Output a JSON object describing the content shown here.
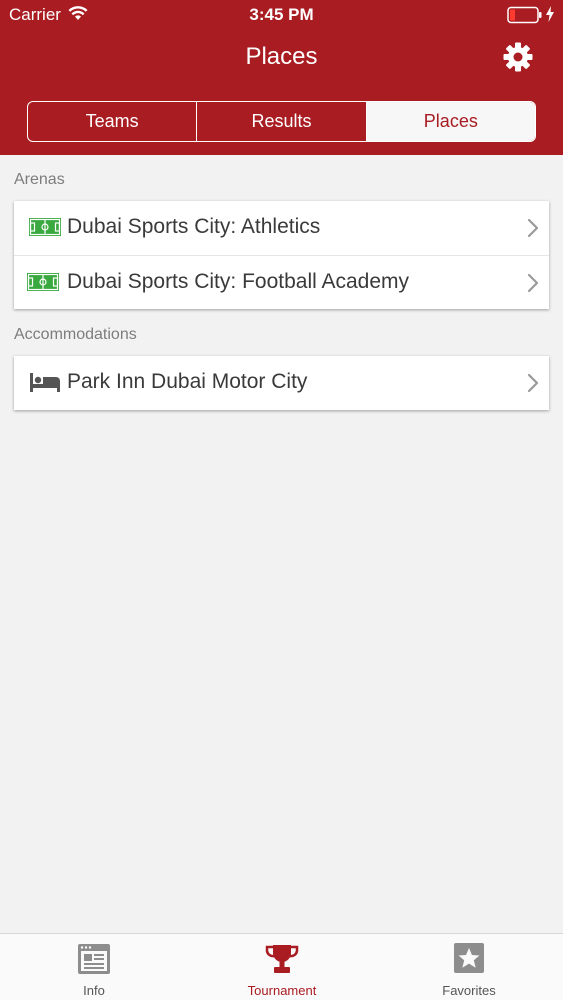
{
  "status_bar": {
    "carrier": "Carrier",
    "time": "3:45 PM"
  },
  "nav": {
    "title": "Places",
    "settings_icon": "gear-icon"
  },
  "segments": [
    {
      "label": "Teams",
      "selected": false
    },
    {
      "label": "Results",
      "selected": false
    },
    {
      "label": "Places",
      "selected": true
    }
  ],
  "sections": [
    {
      "title": "Arenas",
      "items": [
        {
          "label": "Dubai Sports City: Athletics",
          "icon": "football-pitch-icon"
        },
        {
          "label": "Dubai Sports City: Football Academy",
          "icon": "football-pitch-icon"
        }
      ]
    },
    {
      "title": "Accommodations",
      "items": [
        {
          "label": "Park Inn Dubai Motor City",
          "icon": "bed-icon"
        }
      ]
    }
  ],
  "tabbar": {
    "tabs": [
      {
        "label": "Info",
        "icon": "info-browser-icon",
        "active": false
      },
      {
        "label": "Tournament",
        "icon": "trophy-icon",
        "active": true
      },
      {
        "label": "Favorites",
        "icon": "star-icon",
        "active": false
      }
    ]
  },
  "colors": {
    "brand_red": "#a81c22",
    "background": "#f2f2f2",
    "pitch_green": "#3aa93f"
  }
}
